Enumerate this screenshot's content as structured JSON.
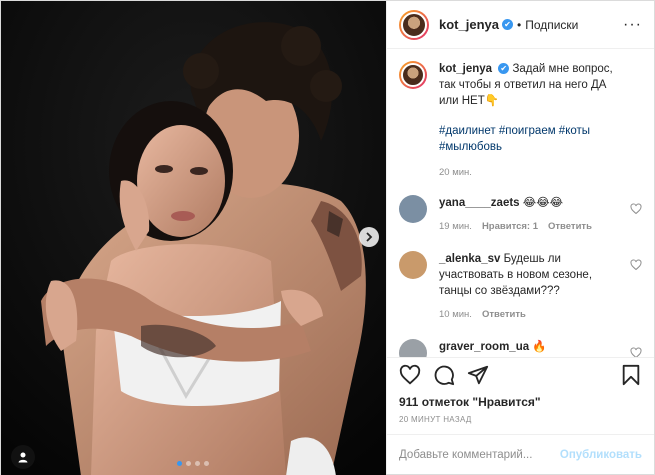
{
  "post": {
    "username": "kot_jenya",
    "verified_mark": "✔",
    "follow_separator": "•",
    "follow_label": "Подписки",
    "more_label": "···"
  },
  "caption": {
    "username": "kot_jenya",
    "text": "Задай мне вопрос, так чтобы я ответил на него ДА или НЕТ👇",
    "hashtags": "#даилинет #поиграем #коты #мылюбовь",
    "time": "20 мин."
  },
  "comments": [
    {
      "username": "yana____zaets",
      "text": "😂😂😂",
      "time": "19 мин.",
      "likes": "Нравится: 1",
      "reply": "Ответить",
      "avatar_color": "#7b8fa3"
    },
    {
      "username": "_alenka_sv",
      "text": "Будешь ли участвовать в новом сезоне, танцы со звёздами???",
      "time": "10 мин.",
      "reply": "Ответить",
      "avatar_color": "#c99a6b"
    },
    {
      "username": "graver_room_ua",
      "text": "🔥",
      "avatar_color": "#9aa0a6"
    }
  ],
  "likes_text": "911 отметок \"Нравится\"",
  "time_ago": "20 МИНУТ НАЗАД",
  "add_comment": {
    "placeholder": "Добавьте комментарий...",
    "publish_label": "Опубликовать"
  },
  "carousel": {
    "count": 4,
    "active_index": 0
  },
  "colors": {
    "link": "#00376b",
    "accent": "#3897f0",
    "muted": "#8e8e8e",
    "publish_disabled": "#b2dffc",
    "photo_bg": "#0a0a0a"
  },
  "icons": [
    "heart-icon",
    "comment-icon",
    "share-icon",
    "bookmark-icon",
    "next-arrow-icon",
    "user-tag-icon",
    "more-options-icon"
  ]
}
